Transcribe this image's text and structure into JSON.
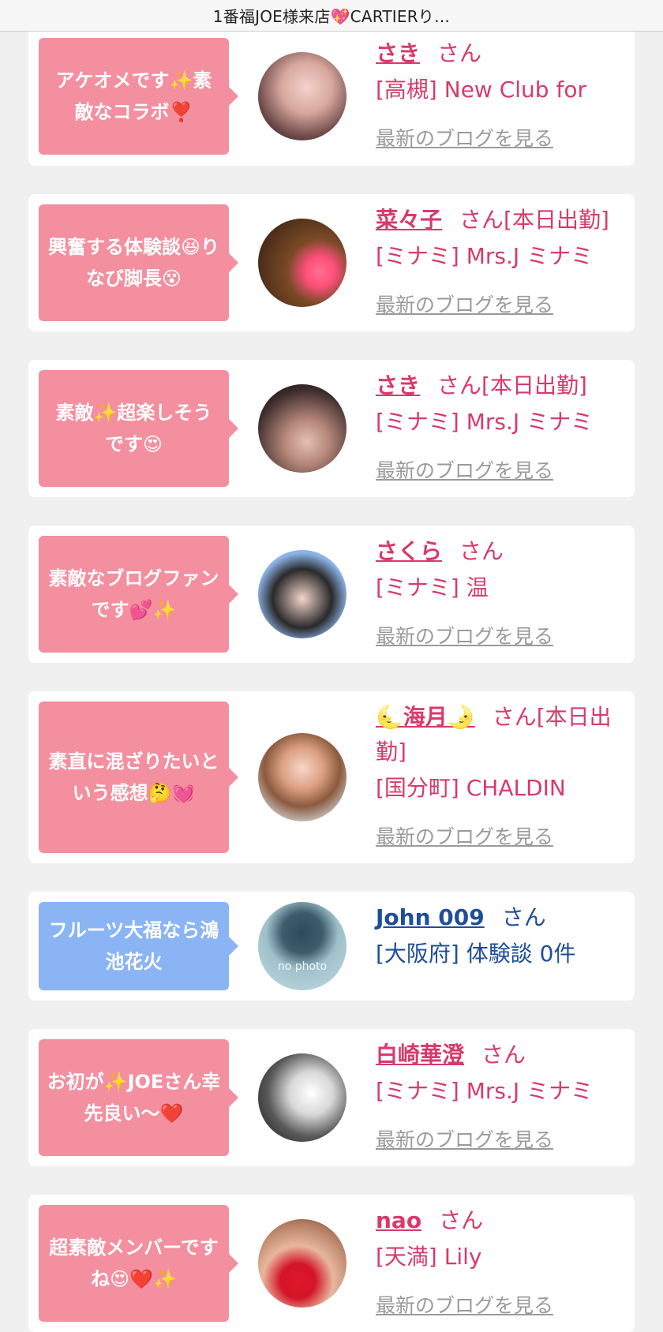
{
  "header": {
    "title": "1番福JOE様来店💖CARTIERり…"
  },
  "colors": {
    "accent_pink": "#d83a6b",
    "bubble_pink": "#f38f9f",
    "bubble_blue": "#8ab4f4",
    "link_blue": "#1f4e9a",
    "blog_gray": "#9a9a9a"
  },
  "entries": [
    {
      "comment": "アケオメです✨素敵なコラボ❣️",
      "name": "さき",
      "suffix": "さん",
      "shop": "[高槻] New Club for",
      "blog_link": "最新のブログを見る",
      "bubble_color": "pink"
    },
    {
      "comment": "興奮する体験談😆りなび脚長😵",
      "name": "菜々子",
      "suffix": "さん[本日出勤]",
      "shop": "[ミナミ] Mrs.J ミナミ",
      "blog_link": "最新のブログを見る",
      "bubble_color": "pink"
    },
    {
      "comment": "素敵✨超楽しそうです😍",
      "name": "さき",
      "suffix": "さん[本日出勤]",
      "shop": "[ミナミ] Mrs.J ミナミ",
      "blog_link": "最新のブログを見る",
      "bubble_color": "pink"
    },
    {
      "comment": "素敵なブログファンです💕✨",
      "name": "さくら",
      "suffix": "さん",
      "shop": "[ミナミ] 温",
      "blog_link": "最新のブログを見る",
      "bubble_color": "pink"
    },
    {
      "comment": "素直に混ざりたいという感想🤔💓",
      "name": "🌜海月🌛",
      "suffix": "さん[本日出勤]",
      "shop": "[国分町] CHALDIN",
      "blog_link": "最新のブログを見る",
      "bubble_color": "pink"
    },
    {
      "comment": "フルーツ大福なら鴻池花火",
      "name": "John 009",
      "suffix": "さん",
      "shop": "[大阪府] 体験談 0件",
      "blog_link": "",
      "bubble_color": "blue",
      "avatar_text": "no photo"
    },
    {
      "comment": "お初が✨JOEさん幸先良い〜❤️",
      "name": "白崎華澄",
      "suffix": "さん",
      "shop": "[ミナミ] Mrs.J ミナミ",
      "blog_link": "最新のブログを見る",
      "bubble_color": "pink"
    },
    {
      "comment": "超素敵メンバーですね😍❤️✨",
      "name": "nao",
      "suffix": "さん",
      "shop": "[天満] Lily",
      "blog_link": "最新のブログを見る",
      "bubble_color": "pink"
    }
  ]
}
